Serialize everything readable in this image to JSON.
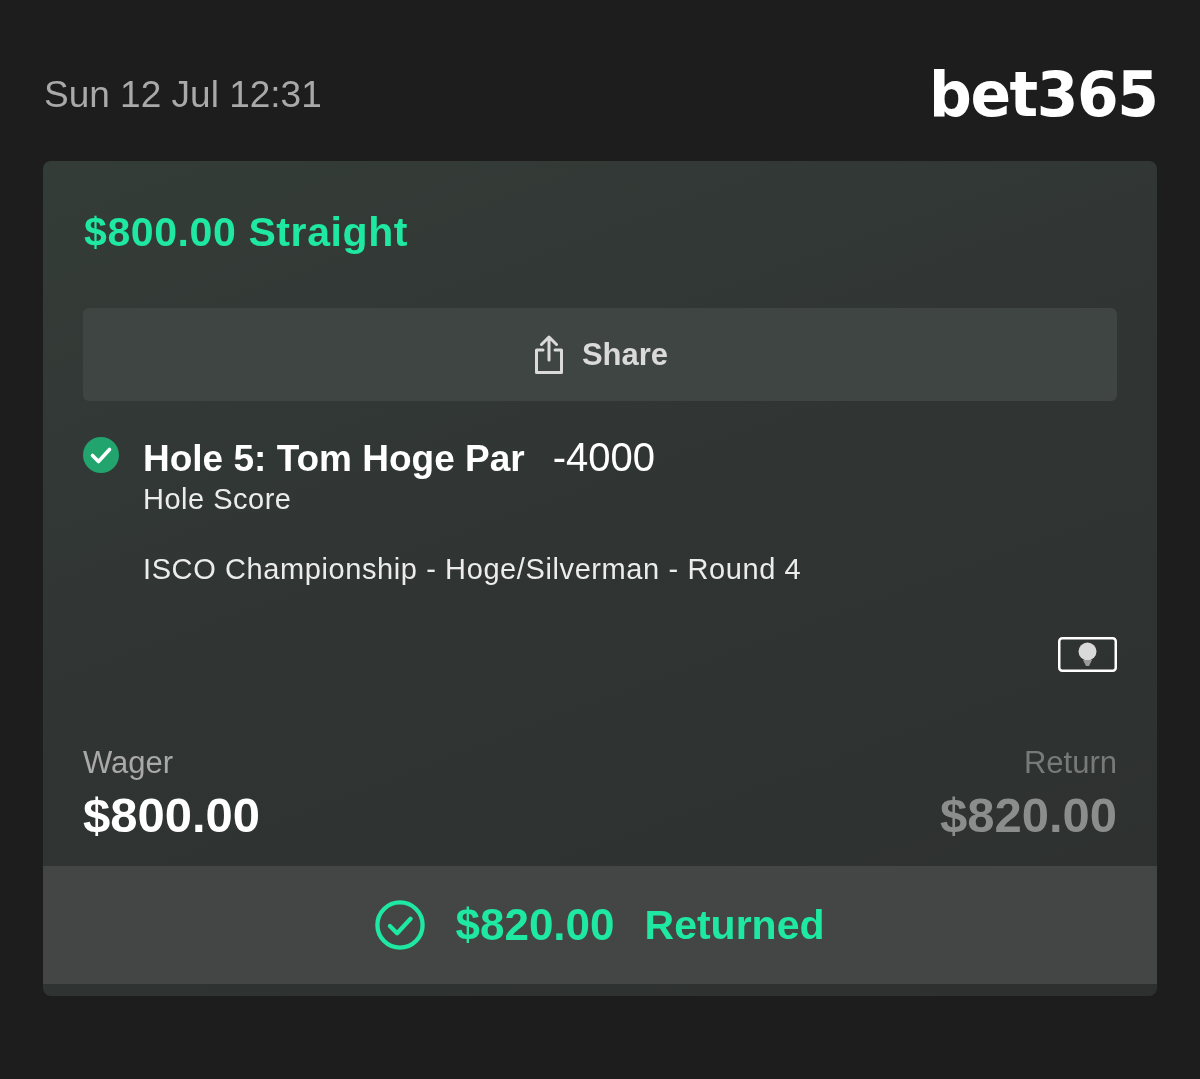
{
  "header": {
    "date": "Sun 12 Jul 12:31",
    "logo": "bet365"
  },
  "bet": {
    "title": "$800.00 Straight",
    "share": {
      "label": "Share"
    },
    "selection": {
      "won": true,
      "name": "Hole 5: Tom Hoge Par",
      "odds": "-4000",
      "market": "Hole Score",
      "event": "ISCO Championship - Hoge/Silverman - Round 4"
    },
    "wager": {
      "label": "Wager",
      "value": "$800.00"
    },
    "return": {
      "label": "Return",
      "value": "$820.00"
    },
    "status": {
      "kind": "returned",
      "amount": "$820.00",
      "label": "Returned"
    }
  }
}
